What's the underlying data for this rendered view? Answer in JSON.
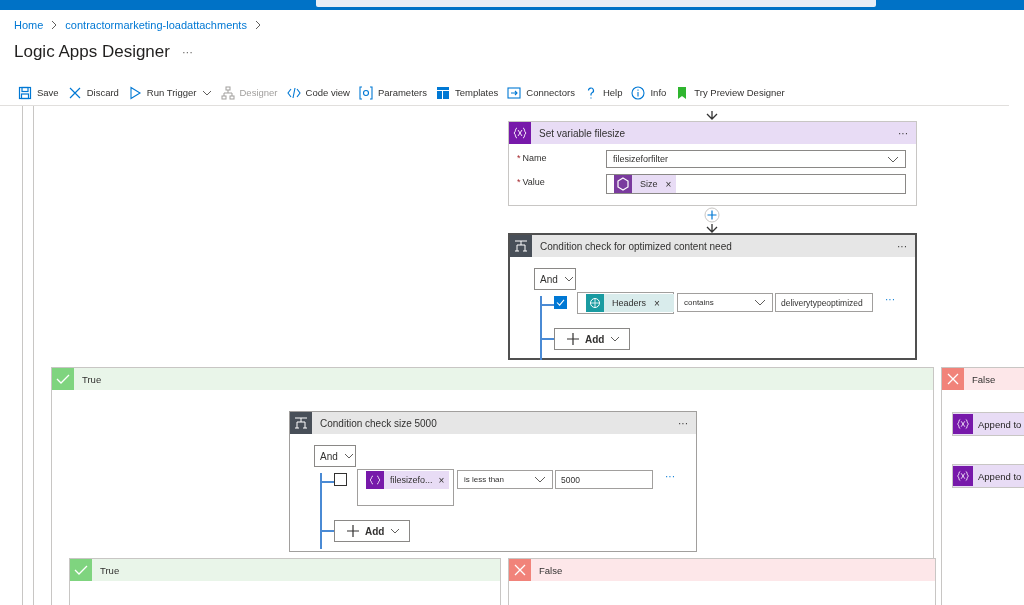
{
  "breadcrumb": [
    {
      "label": "Home"
    },
    {
      "label": "contractormarketing-loadattachments"
    }
  ],
  "page_title": "Logic Apps Designer",
  "title_more": "···",
  "toolbar": [
    {
      "kind": "save",
      "label": "Save",
      "disabled": false
    },
    {
      "kind": "discard",
      "label": "Discard",
      "disabled": false
    },
    {
      "kind": "run",
      "label": "Run Trigger",
      "disabled": false,
      "dropdown": true
    },
    {
      "kind": "designer",
      "label": "Designer",
      "disabled": true
    },
    {
      "kind": "code",
      "label": "Code view",
      "disabled": false
    },
    {
      "kind": "parameters",
      "label": "Parameters",
      "disabled": false
    },
    {
      "kind": "templates",
      "label": "Templates",
      "disabled": false
    },
    {
      "kind": "connectors",
      "label": "Connectors",
      "disabled": false
    },
    {
      "kind": "help",
      "label": "Help",
      "disabled": false
    },
    {
      "kind": "info",
      "label": "Info",
      "disabled": false
    },
    {
      "kind": "preview",
      "label": "Try Preview Designer",
      "disabled": false
    }
  ],
  "canvas": {
    "set_variable": {
      "title": "Set variable filesize",
      "more": "···",
      "fields": [
        {
          "label": "Name",
          "required_mark": "*",
          "kind": "select",
          "value": "filesizeforfilter"
        },
        {
          "label": "Value",
          "required_mark": "*",
          "kind": "token",
          "token": {
            "kind": "body",
            "label": "Size",
            "remove": "×"
          }
        }
      ]
    },
    "conditions": [
      {
        "title": "Condition check for optimized content need",
        "more": "···",
        "group": "And",
        "rows": [
          {
            "checked": true,
            "token": {
              "kind": "trigger",
              "label": "Headers",
              "remove": "×"
            },
            "operator": "contains",
            "value": "deliverytypeoptimized",
            "more": "···"
          }
        ],
        "add": "Add"
      },
      {
        "title": "Condition check size 5000",
        "more": "···",
        "group": "And",
        "rows": [
          {
            "checked": false,
            "token": {
              "kind": "variable",
              "label": "filesizefo...",
              "remove": "×"
            },
            "operator": "is less than",
            "value": "5000",
            "more": "···"
          }
        ],
        "add": "Add"
      }
    ],
    "branches": [
      {
        "kind": "true",
        "label": "True"
      },
      {
        "kind": "false",
        "label": "False",
        "actions": [
          {
            "title": "Append to"
          },
          {
            "title": "Append to"
          }
        ]
      },
      {
        "kind": "true",
        "label": "True"
      },
      {
        "kind": "false",
        "label": "False"
      }
    ]
  }
}
